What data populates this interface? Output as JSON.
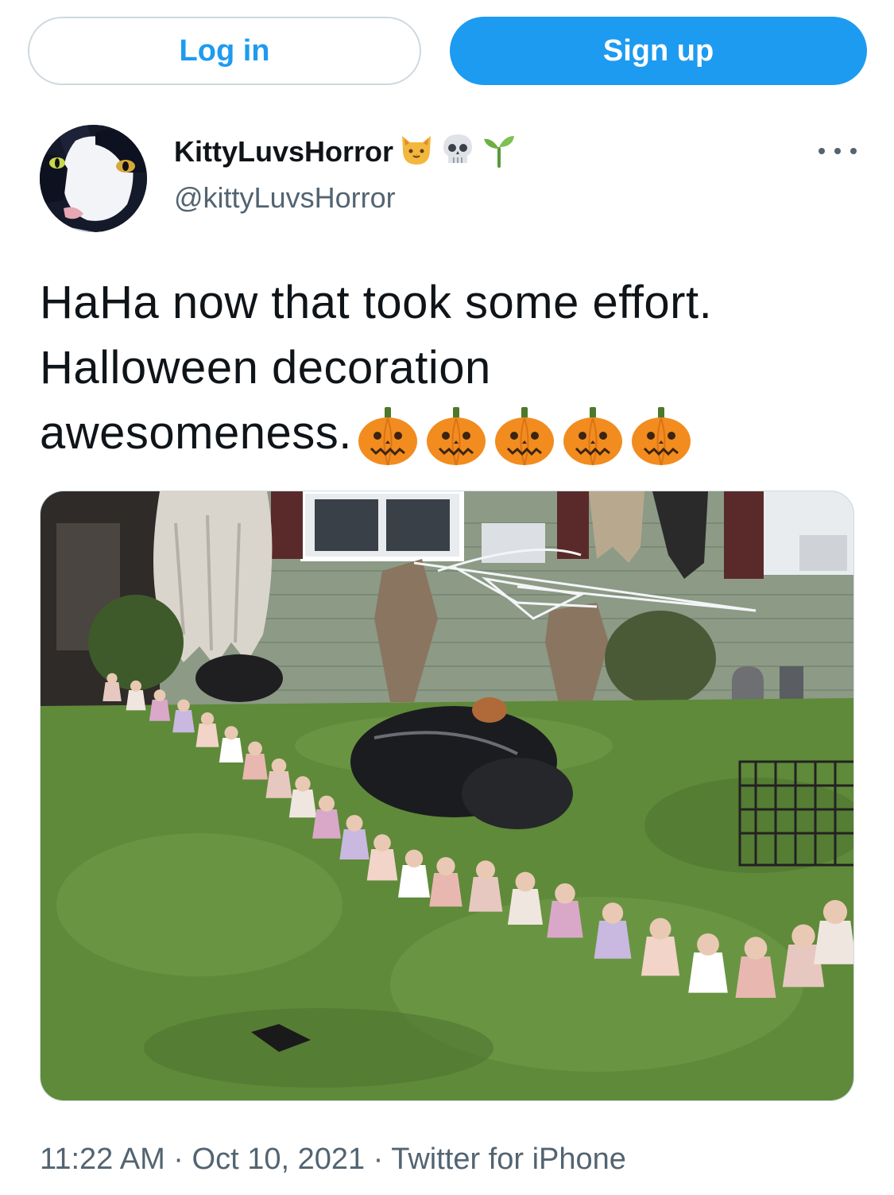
{
  "header": {
    "login_label": "Log in",
    "signup_label": "Sign up"
  },
  "user": {
    "display_name": "KittyLuvsHorror",
    "handle": "@kittyLuvsHorror",
    "name_emojis": [
      "cat-face-icon",
      "skull-icon",
      "seedling-icon"
    ]
  },
  "tweet": {
    "line1": "HaHa now that took some effort.",
    "line2": "Halloween decoration",
    "line3": "awesomeness.",
    "pumpkin_count": 5
  },
  "meta": {
    "time": "11:22 AM",
    "date": "Oct 10, 2021",
    "source": "Twitter for iPhone",
    "separator": "·"
  },
  "colors": {
    "accent": "#1d9bf0",
    "secondary_text": "#536471",
    "border": "#cfd9de"
  }
}
